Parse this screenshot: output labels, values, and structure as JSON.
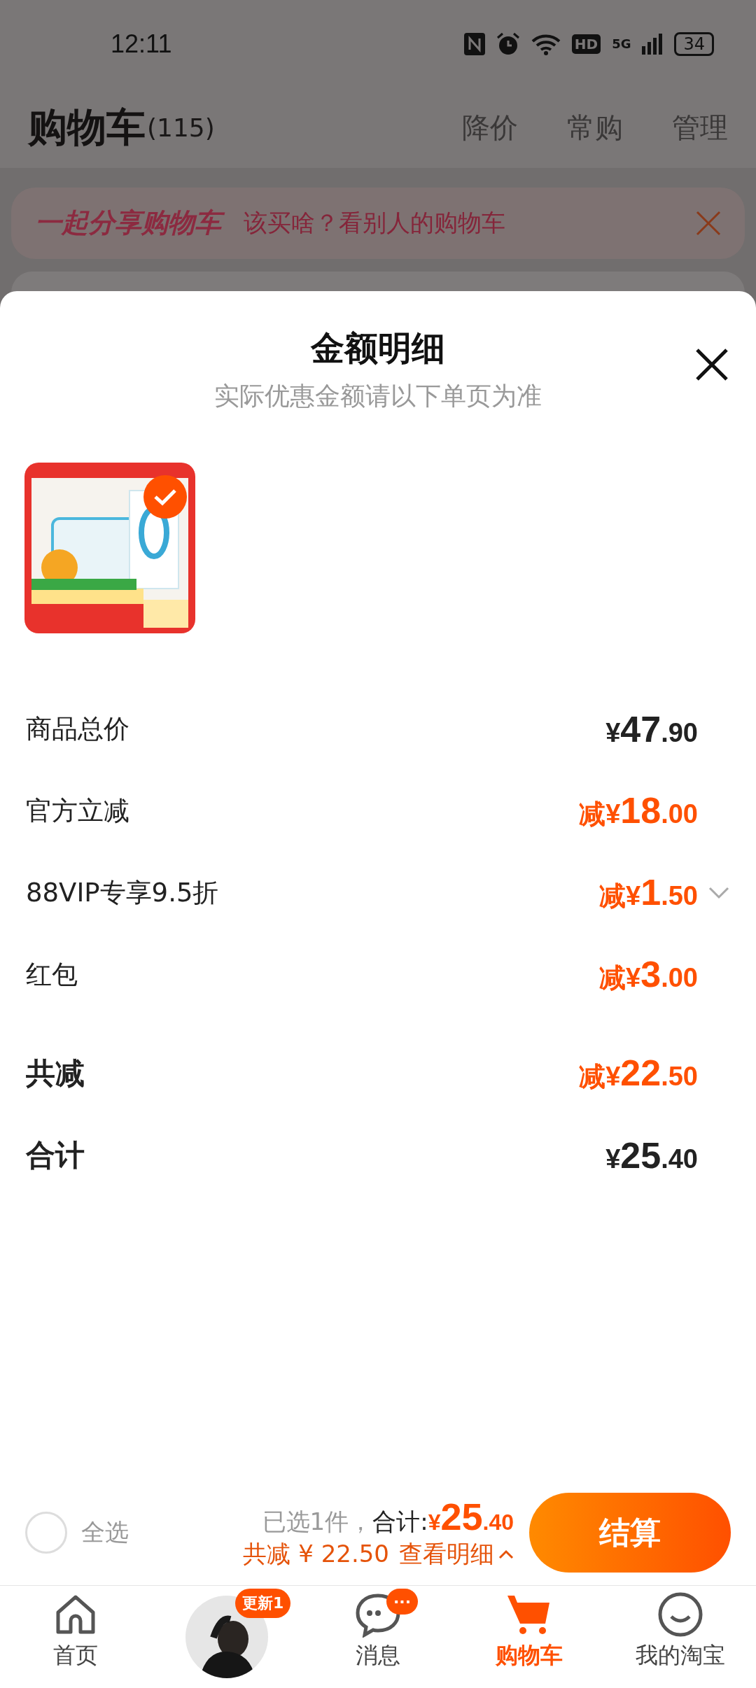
{
  "status_bar": {
    "time": "12:11",
    "hd": "HD",
    "network": "5G",
    "battery": "34"
  },
  "header": {
    "title": "购物车",
    "count": "(115)",
    "actions": [
      "降价",
      "常购",
      "管理"
    ]
  },
  "banner": {
    "title": "一起分享购物车",
    "text": "该买啥？看别人的购物车"
  },
  "sheet": {
    "title": "金额明细",
    "subtitle": "实际优惠金额请以下单页为准",
    "products": [
      {
        "kind": "picture",
        "selected": true
      }
    ],
    "rows": [
      {
        "label": "商品总价",
        "kind": "price",
        "bold": false,
        "prefix": "",
        "currency": "¥",
        "int": "47",
        "dec": ".90",
        "expandable": false
      },
      {
        "label": "官方立减",
        "kind": "discount",
        "bold": false,
        "prefix": "减",
        "currency": "¥",
        "int": "18",
        "dec": ".00",
        "expandable": false
      },
      {
        "label": "88VIP专享9.5折",
        "kind": "discount",
        "bold": false,
        "prefix": "减",
        "currency": "¥",
        "int": "1",
        "dec": ".50",
        "expandable": true
      },
      {
        "label": "红包",
        "kind": "discount",
        "bold": false,
        "prefix": "减",
        "currency": "¥",
        "int": "3",
        "dec": ".00",
        "expandable": false
      },
      {
        "label": "共减",
        "kind": "discount",
        "bold": true,
        "prefix": "减",
        "currency": "¥",
        "int": "22",
        "dec": ".50",
        "expandable": false
      },
      {
        "label": "合计",
        "kind": "price",
        "bold": true,
        "prefix": "",
        "currency": "¥",
        "int": "25",
        "dec": ".40",
        "expandable": false
      }
    ]
  },
  "checkout": {
    "select_all": {
      "label": "全选",
      "checked": false
    },
    "selected_count": "已选1件，",
    "total_label": "合计:",
    "total_currency": "¥",
    "total_int": "25",
    "total_dec": ".40",
    "savings": "共减 ¥ 22.50",
    "detail_link": "查看明细",
    "button": "结算"
  },
  "tab_bar": [
    {
      "kind": "home",
      "label": "首页",
      "selected": false
    },
    {
      "kind": "avatar",
      "badge": "更新1",
      "selected": false
    },
    {
      "kind": "messages",
      "label": "消息",
      "badge": "···",
      "selected": false
    },
    {
      "kind": "cart",
      "label": "购物车",
      "selected": true
    },
    {
      "kind": "profile",
      "label": "我的淘宝",
      "selected": false
    }
  ]
}
